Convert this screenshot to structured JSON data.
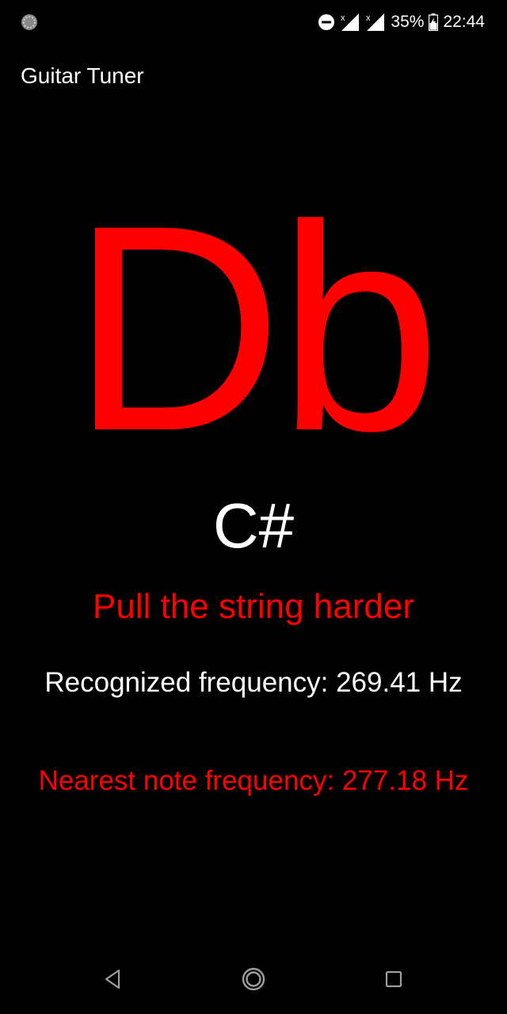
{
  "colors": {
    "background": "#000000",
    "text_primary": "#ffffff",
    "accent_red": "#ff0000",
    "nav_icon": "#9e9e9e"
  },
  "status_bar": {
    "left_icon": "notification-dot-icon",
    "icons": [
      "do-not-disturb-icon",
      "signal-no-data-icon",
      "signal-no-data-icon",
      "battery-charging-icon"
    ],
    "battery": "35%",
    "time": "22:44"
  },
  "app_bar": {
    "title": "Guitar Tuner"
  },
  "tuner": {
    "note": "Db",
    "alternate_note": "C#",
    "hint": "Pull the string harder",
    "recognized_frequency": "Recognized frequency: 269.41 Hz",
    "nearest_note_frequency": "Nearest note frequency: 277.18 Hz"
  },
  "nav_bar": {
    "buttons": [
      "back-icon",
      "home-icon",
      "recents-icon"
    ]
  }
}
